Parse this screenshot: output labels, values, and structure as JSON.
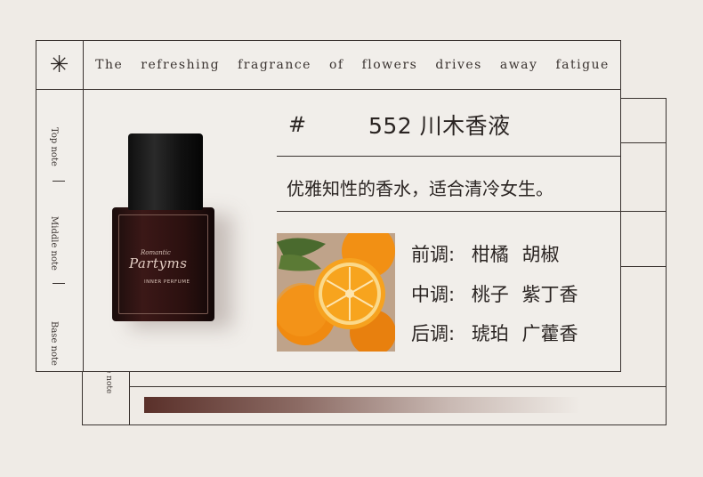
{
  "header": {
    "symbol": "✳",
    "slogan_words": [
      "The",
      "refreshing",
      "fragrance",
      "of",
      "flowers",
      "drives",
      "away",
      "fatigue"
    ]
  },
  "notes_sidebar": {
    "top": "Top note",
    "middle": "Middle note",
    "base": "Base note",
    "back_card_fragment": "ase note"
  },
  "product": {
    "hash": "#",
    "title": "552 川木香液",
    "description": "优雅知性的香水，适合清冷女生。",
    "notes": [
      {
        "key": "前调:",
        "values": [
          "柑橘",
          "胡椒"
        ]
      },
      {
        "key": "中调:",
        "values": [
          "桃子",
          "紫丁香"
        ]
      },
      {
        "key": "后调:",
        "values": [
          "琥珀",
          "广藿香"
        ]
      }
    ]
  },
  "bottle": {
    "brand_small": "Romantic",
    "brand_big": "Partyms",
    "brand_sub": "INNER PERFUME"
  },
  "colors": {
    "background": "#efebe6",
    "line": "#3a3330",
    "bottle_glass": "#3b1817",
    "gradient_start": "#5a302a"
  }
}
